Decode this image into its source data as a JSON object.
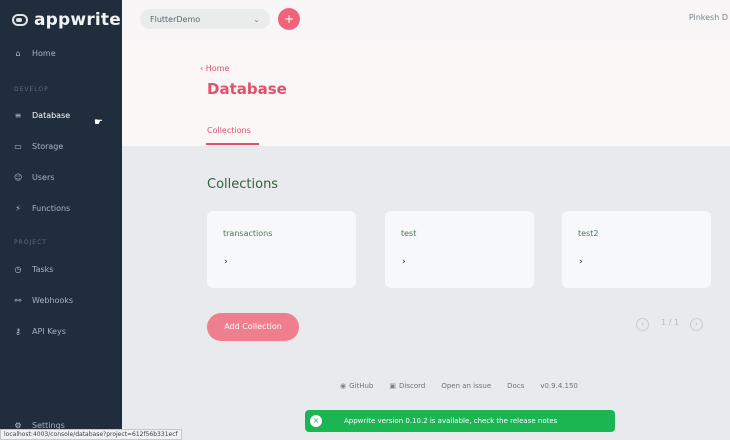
{
  "sidebar": {
    "logo": "appwrite",
    "home": "Home",
    "section_develop": "Develop",
    "items": [
      {
        "label": "Database",
        "icon": "database-icon"
      },
      {
        "label": "Storage",
        "icon": "folder-icon"
      },
      {
        "label": "Users",
        "icon": "users-icon"
      },
      {
        "label": "Functions",
        "icon": "lightning-icon"
      }
    ],
    "section_project": "Project",
    "project_items": [
      {
        "label": "Tasks",
        "icon": "clock-icon"
      },
      {
        "label": "Webhooks",
        "icon": "webhook-icon"
      },
      {
        "label": "API Keys",
        "icon": "key-icon"
      }
    ],
    "settings": "Settings"
  },
  "topbar": {
    "project": "FlutterDemo",
    "add_label": "+",
    "user": "Pinkesh D"
  },
  "header": {
    "breadcrumb": "Home",
    "title": "Database",
    "tab": "Collections"
  },
  "main": {
    "section_title": "Collections",
    "collections": [
      {
        "name": "transactions"
      },
      {
        "name": "test"
      },
      {
        "name": "test2"
      }
    ],
    "add_button": "Add Collection",
    "pager": "1 / 1"
  },
  "footer": {
    "github": "GitHub",
    "discord": "Discord",
    "issue": "Open an issue",
    "docs": "Docs",
    "version": "v0.9.4.150"
  },
  "toast": {
    "message": "Appwrite version 0.10.2 is available, check the release notes"
  },
  "status_url": "localhost:4003/console/database?project=612f56b331ecf",
  "colors": {
    "sidebar": "#1f2d3d",
    "accent": "#e3506a",
    "toast": "#1bb551"
  }
}
